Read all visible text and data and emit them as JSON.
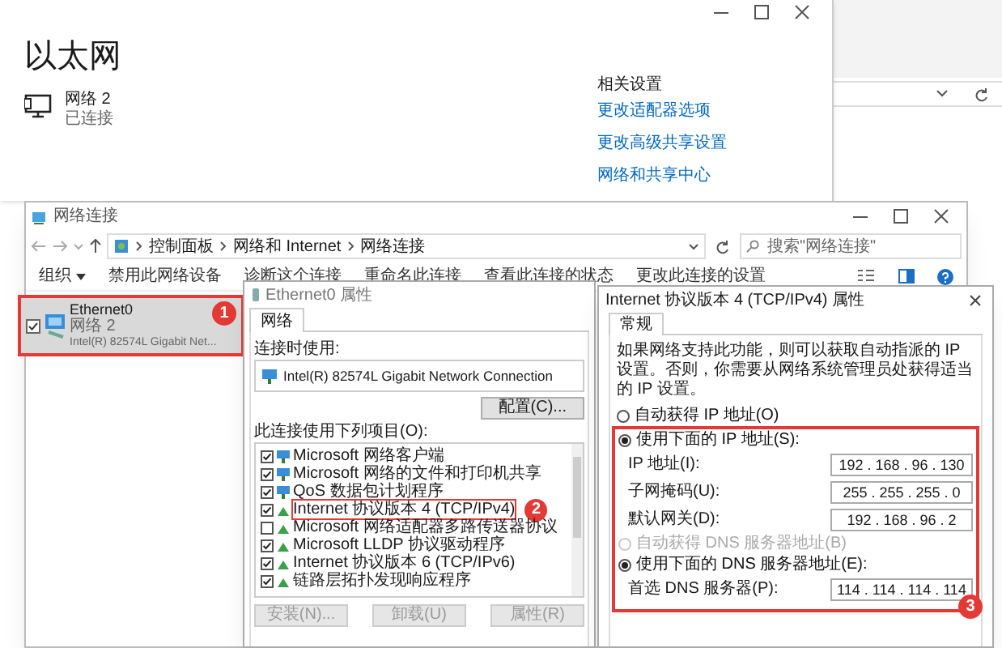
{
  "settings_window": {
    "title": "以太网",
    "network": {
      "name": "网络 2",
      "status": "已连接"
    },
    "related": {
      "heading": "相关设置",
      "links": [
        "更改适配器选项",
        "更改高级共享设置",
        "网络和共享中心"
      ]
    }
  },
  "explorer": {
    "title": "网络连接",
    "breadcrumb": [
      "控制面板",
      "网络和 Internet",
      "网络连接"
    ],
    "search": {
      "placeholder": "搜索\"网络连接\""
    },
    "toolbar": [
      {
        "label": "组织",
        "kind": "menu"
      },
      {
        "label": "禁用此网络设备",
        "kind": "action"
      },
      {
        "label": "诊断这个连接",
        "kind": "action"
      },
      {
        "label": "重命名此连接",
        "kind": "action"
      },
      {
        "label": "查看此连接的状态",
        "kind": "action"
      },
      {
        "label": "更改此连接的设置",
        "kind": "action"
      }
    ],
    "items": [
      {
        "name": "Ethernet0",
        "network": "网络 2",
        "adapter": "Intel(R) 82574L Gigabit Net...",
        "selected": true,
        "checked": true,
        "callout": "1"
      }
    ]
  },
  "ethernet_dialog": {
    "title": "Ethernet0 属性",
    "tabs": [
      {
        "label": "网络",
        "selected": true
      }
    ],
    "connect_using_label": "连接时使用:",
    "adapter": "Intel(R) 82574L Gigabit Network Connection",
    "configure_button": "配置(C)...",
    "items_label": "此连接使用下列项目(O):",
    "items": [
      {
        "label": "Microsoft 网络客户端",
        "checked": true,
        "kind": "service"
      },
      {
        "label": "Microsoft 网络的文件和打印机共享",
        "checked": true,
        "kind": "service"
      },
      {
        "label": "QoS 数据包计划程序",
        "checked": true,
        "kind": "service"
      },
      {
        "label": "Internet 协议版本 4 (TCP/IPv4)",
        "checked": true,
        "kind": "protocol",
        "callout": "2"
      },
      {
        "label": "Microsoft 网络适配器多路传送器协议",
        "checked": false,
        "kind": "protocol"
      },
      {
        "label": "Microsoft LLDP 协议驱动程序",
        "checked": true,
        "kind": "protocol"
      },
      {
        "label": "Internet 协议版本 6 (TCP/IPv6)",
        "checked": true,
        "kind": "protocol"
      },
      {
        "label": "链路层拓扑发现响应程序",
        "checked": true,
        "kind": "protocol"
      }
    ],
    "buttons": [
      {
        "label": "安装(N)...",
        "disabled": true
      },
      {
        "label": "卸载(U)",
        "disabled": true
      },
      {
        "label": "属性(R)",
        "disabled": true
      }
    ]
  },
  "ipv4_dialog": {
    "title": "Internet 协议版本 4 (TCP/IPv4) 属性",
    "tabs": [
      {
        "label": "常规",
        "selected": true
      }
    ],
    "description": "如果网络支持此功能，则可以获取自动指派的 IP 设置。否则，你需要从网络系统管理员处获得适当的 IP 设置。",
    "ip_mode": [
      {
        "label": "自动获得 IP 地址(O)",
        "selected": false,
        "disabled": false
      },
      {
        "label": "使用下面的 IP 地址(S):",
        "selected": true,
        "disabled": false
      }
    ],
    "ip_fields": [
      {
        "label": "IP 地址(I):",
        "value": "192 . 168 . 96 . 130"
      },
      {
        "label": "子网掩码(U):",
        "value": "255 . 255 . 255 . 0"
      },
      {
        "label": "默认网关(D):",
        "value": "192 . 168 . 96 . 2"
      }
    ],
    "dns_mode": [
      {
        "label": "自动获得 DNS 服务器地址(B)",
        "selected": false,
        "disabled": true
      },
      {
        "label": "使用下面的 DNS 服务器地址(E):",
        "selected": true,
        "disabled": false
      }
    ],
    "dns_fields": [
      {
        "label": "首选 DNS 服务器(P):",
        "value": "114 . 114 . 114 . 114"
      }
    ],
    "callout": "3"
  }
}
